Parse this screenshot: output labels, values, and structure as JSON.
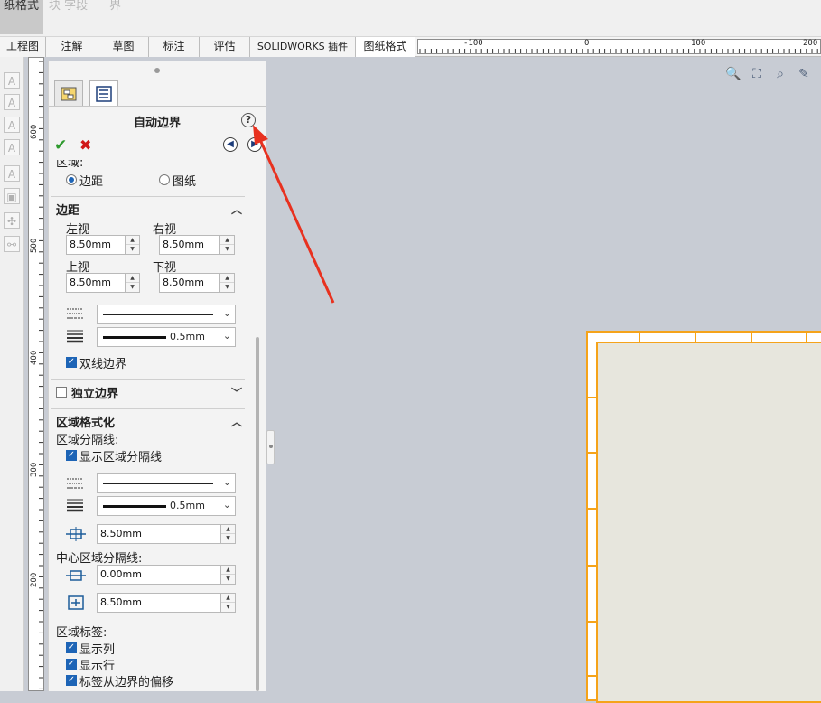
{
  "ribbon_top": {
    "active_label": "纸格式",
    "faded_items": [
      "块 字段",
      "界"
    ]
  },
  "tabs": [
    {
      "label": "工程图"
    },
    {
      "label": "注解"
    },
    {
      "label": "草图"
    },
    {
      "label": "标注"
    },
    {
      "label": "评估"
    },
    {
      "label": "SOLIDWORKS 插件"
    },
    {
      "label": "图纸格式"
    }
  ],
  "ruler": {
    "labels": [
      "-100",
      "0",
      "100",
      "200"
    ]
  },
  "vertical_ruler": {
    "labels": [
      "600",
      "500",
      "400",
      "300",
      "200"
    ]
  },
  "property_manager": {
    "title": "自动边界",
    "help_icon": "?",
    "area_label": "区域:",
    "area_options": [
      {
        "label": "边距",
        "selected": true
      },
      {
        "label": "图纸",
        "selected": false
      }
    ],
    "margins": {
      "group_label": "边距",
      "left_label": "左视",
      "left_value": "8.50mm",
      "right_label": "右视",
      "right_value": "8.50mm",
      "top_label": "上视",
      "top_value": "8.50mm",
      "bottom_label": "下视",
      "bottom_value": "8.50mm",
      "line_weight": "0.5mm",
      "double_border_label": "双线边界",
      "double_border_checked": true
    },
    "independent_border": {
      "label": "独立边界",
      "checked": false
    },
    "zone_format": {
      "group_label": "区域格式化",
      "zone_dividers_label": "区域分隔线:",
      "show_dividers_label": "显示区域分隔线",
      "show_dividers_checked": true,
      "line_weight": "0.5mm",
      "divider_offset": "8.50mm",
      "center_dividers_label": "中心区域分隔线:",
      "center_offset": "0.00mm",
      "center_length": "8.50mm",
      "zone_labels_label": "区域标签:",
      "show_columns_label": "显示列",
      "show_columns_checked": true,
      "show_rows_label": "显示行",
      "show_rows_checked": true,
      "label_offset_label": "标签从边界的偏移",
      "label_offset_checked": true
    }
  },
  "colors": {
    "sheet_border": "#f5a31a",
    "canvas_bg": "#c8ccd4",
    "arrow": "#e8311f",
    "check_blue": "#1d64b6"
  }
}
